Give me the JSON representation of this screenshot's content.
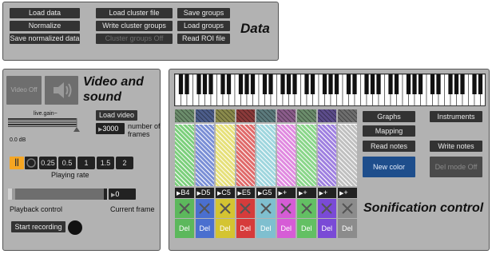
{
  "data_panel": {
    "title": "Data",
    "col1": [
      "Load data",
      "Normalize",
      "Save normalized data"
    ],
    "col2": [
      "Load cluster file",
      "Write cluster groups",
      "Cluster groups Off"
    ],
    "col3": [
      "Save groups",
      "Load groups",
      "Read ROI file"
    ]
  },
  "video_panel": {
    "title_line1": "Video and",
    "title_line2": "sound",
    "video_off": "Video Off",
    "gain_label": "live.gain~",
    "gain_db": "0.0 dB",
    "load_video": "Load video",
    "frames_value": "3000",
    "frames_label_1": "number of",
    "frames_label_2": "frames",
    "pause_icon": "||",
    "rates": [
      "0.25",
      "0.5",
      "1",
      "1.5",
      "2"
    ],
    "playing_rate": "Playing rate",
    "current_frame_value": "0",
    "playback_control": "Playback control",
    "current_frame": "Current frame",
    "start_recording": "Start recording",
    "playback_level": 0.04
  },
  "sonification_panel": {
    "title": "Sonification control",
    "columns": [
      {
        "note": "B4",
        "top": "#6b8c6b",
        "body": "#7ccf7c",
        "del": "#5cb85c",
        "del_label": "Del"
      },
      {
        "note": "D5",
        "top": "#4c5d8a",
        "body": "#7a8fd6",
        "del": "#4a6fcf",
        "del_label": "Del"
      },
      {
        "note": "C5",
        "top": "#8a8a4c",
        "body": "#e6e07a",
        "del": "#d4c431",
        "del_label": "Del"
      },
      {
        "note": "E5",
        "top": "#8a3a3a",
        "body": "#e06a6a",
        "del": "#d63b3b",
        "del_label": "Del"
      },
      {
        "note": "G5",
        "top": "#5c7a7c",
        "body": "#9fd6de",
        "del": "#7fbfcf",
        "del_label": "Del"
      },
      {
        "note": "+",
        "top": "#8a5c8a",
        "body": "#e08ae0",
        "del": "#d65cd6",
        "del_label": "Del"
      },
      {
        "note": "+",
        "top": "#6b8c6b",
        "body": "#8ad68a",
        "del": "#63c063",
        "del_label": "Del"
      },
      {
        "note": "+",
        "top": "#5c4c8a",
        "body": "#9f80e0",
        "del": "#7a4ad6",
        "del_label": "Del"
      },
      {
        "note": "+",
        "top": "#6e6e6e",
        "body": "#c0c0c0",
        "del": "#8c8c8c",
        "del_label": "Del"
      }
    ],
    "graphs": "Graphs",
    "mapping": "Mapping",
    "read_notes": "Read notes",
    "new_color": "New color",
    "instruments": "Instruments",
    "write_notes": "Write notes",
    "del_mode": "Del mode Off"
  }
}
